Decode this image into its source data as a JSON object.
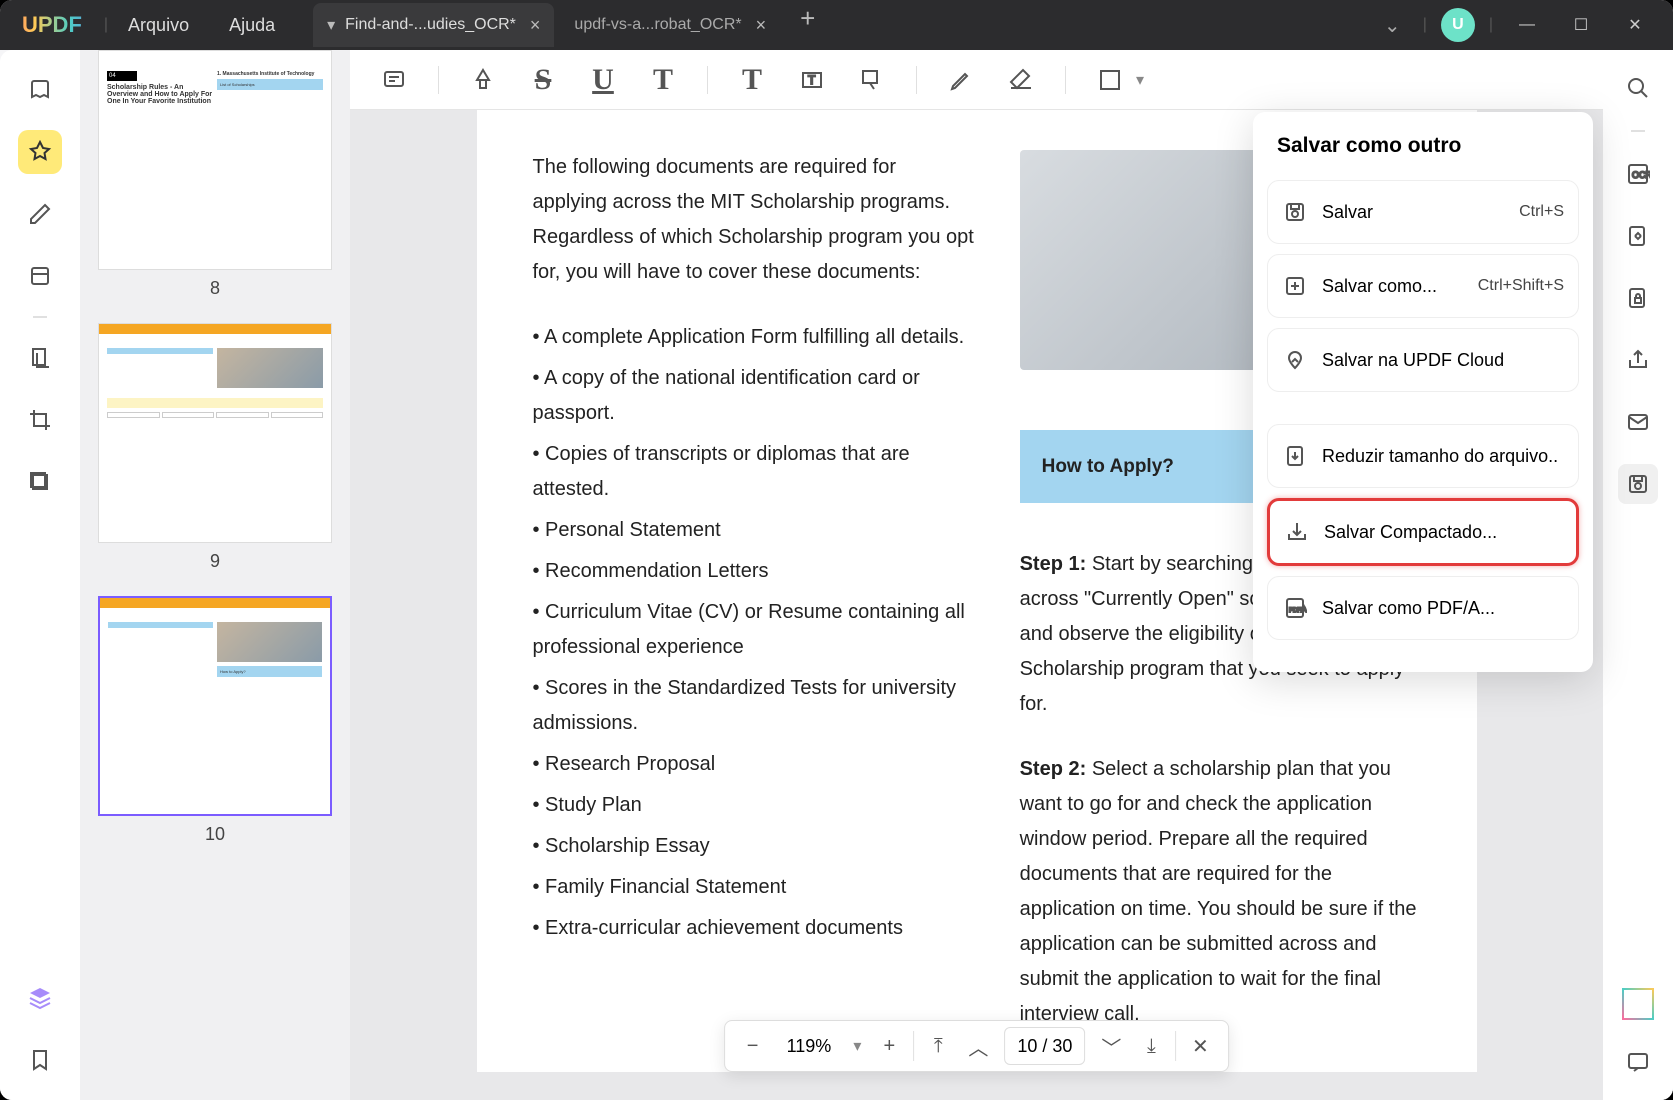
{
  "titlebar": {
    "logo": "UPDF",
    "menu": {
      "file": "Arquivo",
      "help": "Ajuda"
    },
    "tabs": [
      {
        "label": "Find-and-...udies_OCR*",
        "active": true
      },
      {
        "label": "updf-vs-a...robat_OCR*",
        "active": false
      }
    ],
    "avatar_initial": "U"
  },
  "thumbnails": [
    {
      "num": "8"
    },
    {
      "num": "9"
    },
    {
      "num": "10"
    }
  ],
  "doc": {
    "intro": "The following documents are required for applying across the MIT Scholarship programs. Regardless of which Scholarship program you opt for, you will have to cover these documents:",
    "bullets": [
      "A complete Application Form fulfilling all details.",
      "A copy of the national identification card or passport.",
      "Copies of transcripts or diplomas that are attested.",
      "Personal Statement",
      "Recommendation Letters",
      "Curriculum Vitae (CV) or Resume containing all professional experience",
      "Scores in the Standardized Tests for university admissions.",
      "Research Proposal",
      "Study Plan",
      "Scholarship Essay",
      "Family Financial Statement",
      "Extra-curricular achievement documents"
    ],
    "callout": "How to Apply?",
    "step1_label": "Step 1:",
    "step1": " Start by searching Webpage of MIT across \"Currently Open\" scholarships section and observe the eligibility criteria for the Scholarship program that you seek to apply for.",
    "step2_label": "Step 2:",
    "step2": " Select a scholarship plan that you want to go for and check the application window period. Prepare all the required documents that are required for the application on time. You should be sure if the application can be submitted across and submit the application to wait for the final interview call."
  },
  "panel": {
    "title": "Salvar como outro",
    "items": [
      {
        "label": "Salvar",
        "shortcut": "Ctrl+S"
      },
      {
        "label": "Salvar como...",
        "shortcut": "Ctrl+Shift+S"
      },
      {
        "label": "Salvar na UPDF Cloud",
        "shortcut": ""
      }
    ],
    "items2": [
      {
        "label": "Reduzir tamanho do arquivo..",
        "hl": false
      },
      {
        "label": "Salvar Compactado...",
        "hl": true
      },
      {
        "label": "Salvar como PDF/A...",
        "hl": false
      }
    ]
  },
  "pager": {
    "zoom": "119%",
    "page": "10 / 30"
  }
}
